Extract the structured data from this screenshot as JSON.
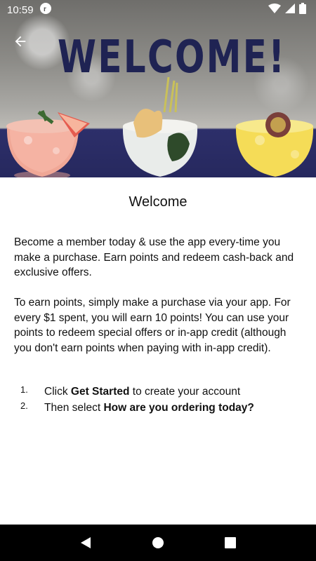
{
  "status_bar": {
    "time": "10:59",
    "icons": [
      "app-notification-icon",
      "wifi-icon",
      "signal-icon",
      "battery-icon"
    ]
  },
  "hero": {
    "banner_text": "WELCOME!",
    "back_icon": "arrow-back-icon"
  },
  "content": {
    "title": "Welcome",
    "paragraph1": "Become a member today & use the app every-time you make a purchase. Earn points and redeem cash-back and exclusive offers.",
    "paragraph2": "To earn points, simply make a purchase via your app. For every $1 spent, you will earn 10 points! You can use your points to redeem special offers or in-app credit (although you don't earn points when paying with in-app credit).",
    "steps": [
      {
        "number": "1.",
        "prefix": "Click ",
        "bold": "Get Started",
        "suffix": " to create your account"
      },
      {
        "number": "2.",
        "prefix": "Then select ",
        "bold": "How are you ordering today?",
        "suffix": ""
      }
    ]
  },
  "nav_bar": {
    "icons": [
      "back-triangle-icon",
      "home-circle-icon",
      "recents-square-icon"
    ]
  },
  "colors": {
    "banner_text": "#1f2353",
    "nav_bar": "#000000",
    "background": "#ffffff"
  }
}
